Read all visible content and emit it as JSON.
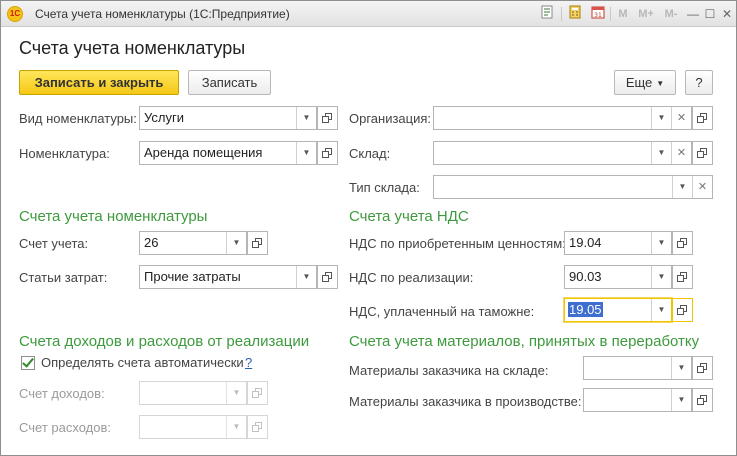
{
  "window": {
    "title": "Счета учета номенклатуры  (1С:Предприятие)",
    "logo": "1С",
    "toolbar": {
      "m": "M",
      "m_plus": "M+",
      "m_minus": "M-",
      "minimize": "—",
      "maximize": "☐",
      "close": "✕"
    }
  },
  "page_title": "Счета учета номенклатуры",
  "buttons": {
    "save_close": "Записать и закрыть",
    "save": "Записать",
    "more": "Еще",
    "help": "?"
  },
  "left": {
    "kind": {
      "label": "Вид номенклатуры:",
      "value": "Услуги"
    },
    "nomenclature": {
      "label": "Номенклатура:",
      "value": "Аренда помещения"
    },
    "section_accounts": "Счета учета номенклатуры",
    "account": {
      "label": "Счет учета:",
      "value": "26"
    },
    "expenses": {
      "label": "Статьи затрат:",
      "value": "Прочие затраты"
    },
    "section_income": "Счета доходов и расходов от реализации",
    "auto_checkbox": {
      "label": "Определять счета автоматически",
      "checked": true,
      "help": "?"
    },
    "income_account": {
      "label": "Счет доходов:",
      "value": ""
    },
    "expense_account": {
      "label": "Счет расходов:",
      "value": ""
    }
  },
  "right": {
    "organization": {
      "label": "Организация:",
      "value": ""
    },
    "warehouse": {
      "label": "Склад:",
      "value": ""
    },
    "warehouse_type": {
      "label": "Тип склада:",
      "value": ""
    },
    "section_vat": "Счета учета НДС",
    "vat_acquired": {
      "label": "НДС по приобретенным ценностям:",
      "value": "19.04"
    },
    "vat_sales": {
      "label": "НДС по реализации:",
      "value": "90.03"
    },
    "vat_customs": {
      "label": "НДС, уплаченный на таможне:",
      "value": "19.05"
    },
    "section_materials": "Счета учета материалов, принятых в переработку",
    "materials_warehouse": {
      "label": "Материалы заказчика на складе:",
      "value": ""
    },
    "materials_production": {
      "label": "Материалы заказчика в производстве:",
      "value": ""
    }
  }
}
